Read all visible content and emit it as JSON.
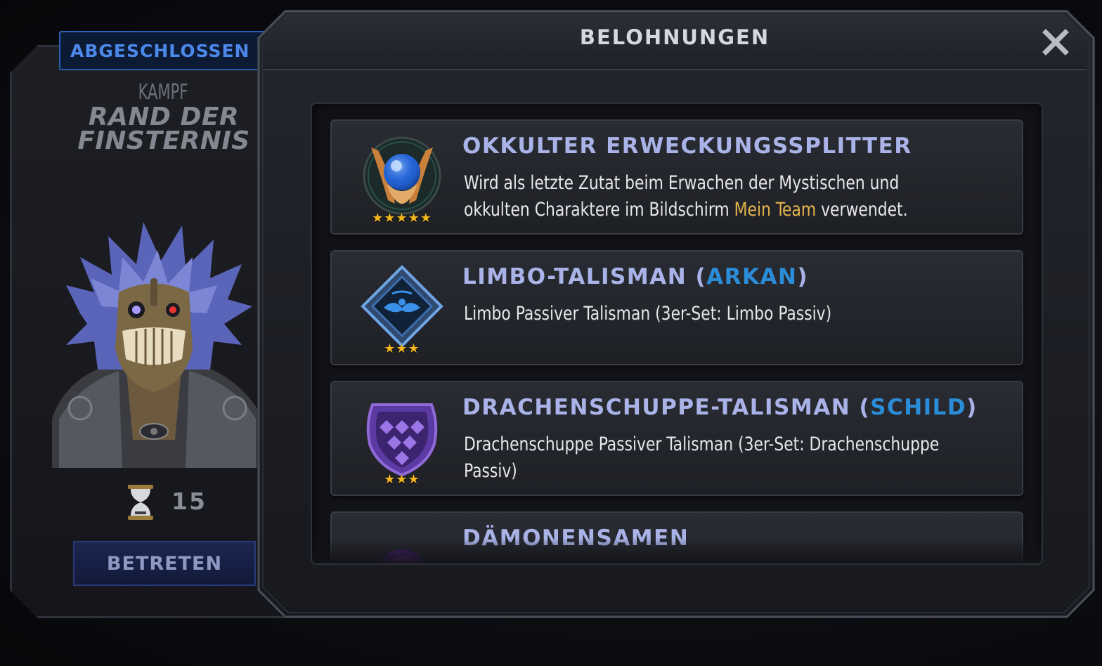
{
  "mission": {
    "status": "ABGESCHLOSSEN",
    "type": "KAMPF",
    "name_line1": "RAND DER",
    "name_line2": "FINSTERNIS",
    "timer_value": "15",
    "enter_label": "BETRETEN"
  },
  "popup": {
    "title": "BELOHNUNGEN",
    "close_icon": "close-x"
  },
  "rewards": [
    {
      "name": "OKKULTER ERWECKUNGSSPLITTER",
      "tag_open": "",
      "tag": "",
      "tag_close": "",
      "stars": "★★★★★",
      "star_count": 5,
      "desc_before": "Wird als letzte Zutat beim Erwachen der Mystischen und okkulten Charaktere im Bildschirm ",
      "desc_highlight": "Mein Team",
      "desc_after": " verwendet.",
      "icon": "occult-awakening-shard-icon"
    },
    {
      "name": "LIMBO-TALISMAN ",
      "tag_open": "(",
      "tag": "ARKAN",
      "tag_close": ")",
      "stars": "★★★",
      "star_count": 3,
      "desc_before": "Limbo Passiver Talisman (3er-Set: Limbo Passiv)",
      "desc_highlight": "",
      "desc_after": "",
      "icon": "limbo-talisman-icon"
    },
    {
      "name": "DRACHENSCHUPPE-TALISMAN ",
      "tag_open": "(",
      "tag": "SCHILD",
      "tag_close": ")",
      "stars": "★★★",
      "star_count": 3,
      "desc_before": "Drachenschuppe Passiver Talisman (3er-Set: Drachenschuppe Passiv)",
      "desc_highlight": "",
      "desc_after": "",
      "icon": "dragonscale-talisman-icon"
    },
    {
      "name": "DÄMONENSAMEN",
      "tag_open": "",
      "tag": "",
      "tag_close": "",
      "stars": "",
      "star_count": 0,
      "desc_before": "",
      "desc_highlight": "",
      "desc_after": "",
      "icon": "demon-seed-icon"
    }
  ],
  "colors": {
    "reward_name": "#a9b3e8",
    "reward_tag": "#2b8cd8",
    "highlight": "#e3b34a",
    "stars": "#f4b81d",
    "status_badge": "#4c88ea"
  }
}
